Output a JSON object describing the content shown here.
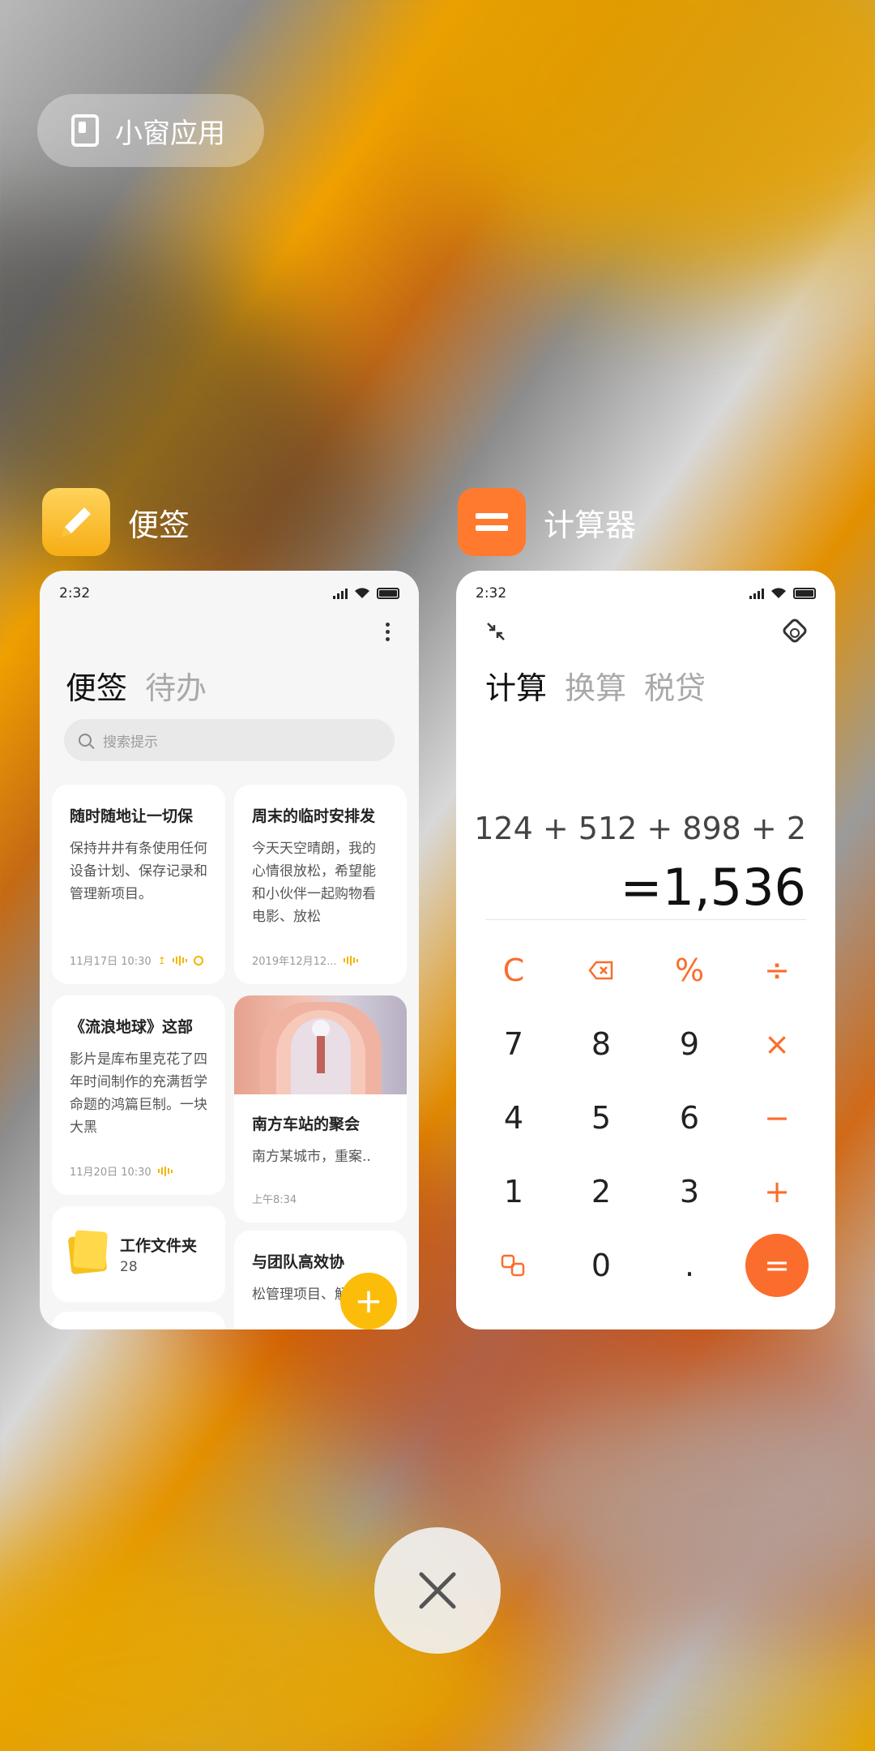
{
  "floating_window": {
    "label": "小窗应用",
    "icon": "floating-window-icon"
  },
  "notes_app": {
    "name": "便签",
    "status_time": "2:32",
    "tabs": [
      "便签",
      "待办"
    ],
    "search_placeholder": "搜索提示",
    "notes": [
      {
        "title": "随时随地让一切保",
        "body": "保持井井有条使用任何设备计划、保存记录和管理新项目。",
        "footer": "11月17日 10:30"
      },
      {
        "title": "周末的临时安排发",
        "body": "今天天空晴朗，我的心情很放松，希望能和小伙伴一起购物看电影、放松",
        "footer": "2019年12月12..."
      },
      {
        "title": "《流浪地球》这部",
        "body": "影片是库布里克花了四年时间制作的充满哲学命题的鸿篇巨制。一块大黑",
        "footer": "11月20日 10:30"
      },
      {
        "title": "南方车站的聚会",
        "body": "南方某城市，重案..",
        "footer": "上午8:34"
      },
      {
        "title": "与团队高效协",
        "body": "松管理项目、解"
      }
    ],
    "folder": {
      "name": "工作文件夹",
      "count": "28"
    },
    "fab_label": "+"
  },
  "calc_app": {
    "name": "计算器",
    "status_time": "2:32",
    "tabs": [
      "计算",
      "换算",
      "税贷"
    ],
    "expression": "124 + 512 + 898 + 2",
    "result": "=1,536",
    "keys": {
      "clear": "C",
      "percent": "%",
      "divide": "÷",
      "multiply": "×",
      "minus": "−",
      "plus": "+",
      "equals": "=",
      "d7": "7",
      "d8": "8",
      "d9": "9",
      "d4": "4",
      "d5": "5",
      "d6": "6",
      "d1": "1",
      "d2": "2",
      "d3": "3",
      "d0": "0",
      "dot": "."
    }
  },
  "close_button": {
    "icon": "close-icon"
  },
  "colors": {
    "accent_orange": "#fb6d2c",
    "notes_yellow": "#fbbd0a"
  }
}
